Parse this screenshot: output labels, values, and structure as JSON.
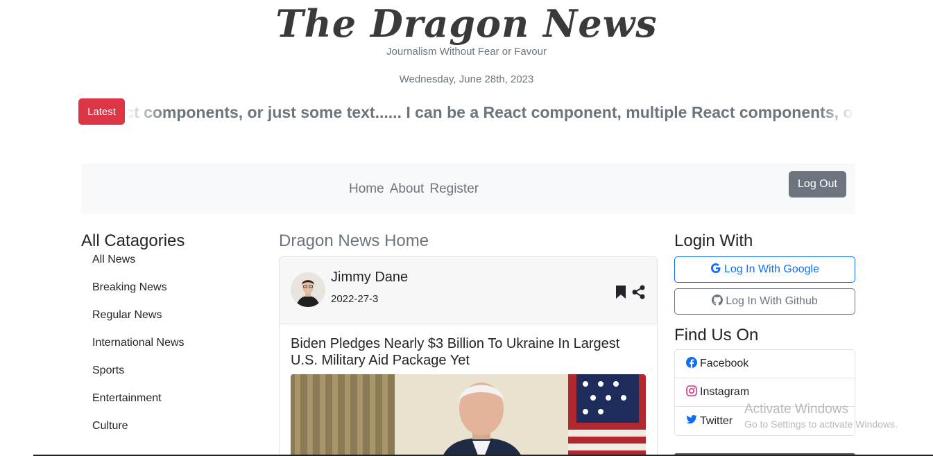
{
  "header": {
    "brand": "The Dragon News",
    "tagline": "Journalism Without Fear or Favour",
    "date": "Wednesday, June 28th, 2023"
  },
  "ticker": {
    "button_label": "Latest",
    "text": "React components, or just some text...... I can be a React component, multiple React components, or just some text......"
  },
  "navbar": {
    "links": [
      "Home",
      "About",
      "Register"
    ],
    "logout_label": "Log Out"
  },
  "left": {
    "title": "All Catagories",
    "categories": [
      "All News",
      "Breaking News",
      "Regular News",
      "International News",
      "Sports",
      "Entertainment",
      "Culture"
    ]
  },
  "main": {
    "title": "Dragon News Home",
    "card": {
      "author": "Jimmy Dane",
      "date": "2022-27-3",
      "headline": "Biden Pledges Nearly $3 Billion To Ukraine In Largest U.S. Military Aid Package Yet"
    }
  },
  "right": {
    "login_title": "Login With",
    "google_label": "Log In With Google",
    "github_label": "Log In With Github",
    "find_title": "Find Us On",
    "social": [
      "Facebook",
      "Instagram",
      "Twitter"
    ]
  },
  "watermark": {
    "line1": "Activate Windows",
    "line2": "Go to Settings to activate Windows."
  },
  "colors": {
    "danger": "#dc3545",
    "primary": "#0d6efd",
    "secondary": "#6c757d",
    "navbar_bg": "#f8f9fa"
  }
}
